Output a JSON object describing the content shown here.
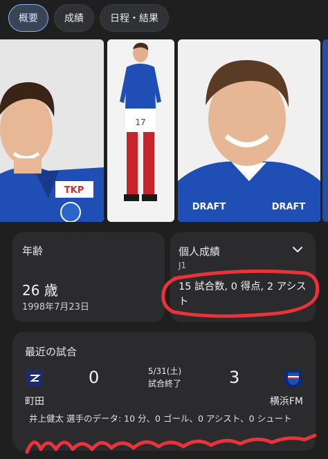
{
  "tabs": [
    {
      "label": "概要",
      "active": true
    },
    {
      "label": "成績",
      "active": false
    },
    {
      "label": "日程・結果",
      "active": false
    }
  ],
  "age_card": {
    "title": "年齢",
    "value": "26 歳",
    "birthdate": "1998年7月23日"
  },
  "stats_card": {
    "title": "個人成績",
    "league": "J1",
    "summary": "15 試合数, 0 得点, 2 アシスト"
  },
  "match_card": {
    "title": "最近の試合",
    "home_team": "町田",
    "away_team": "横浜FM",
    "home_score": "0",
    "away_score": "3",
    "date": "5/31(土)",
    "status": "試合終了",
    "player_note": "井上健太 選手のデータ: 10 分、0 ゴール、0 アシスト、0 シュート"
  },
  "photos": {
    "ads": [
      "TKP",
      "DRAFT",
      "DRAFT"
    ],
    "jersey_number": "17"
  },
  "colors": {
    "background": "#1f1f1f",
    "card": "#2b2b2d",
    "annotation": "#e8333b",
    "kit_blue": "#1f4fb4"
  }
}
